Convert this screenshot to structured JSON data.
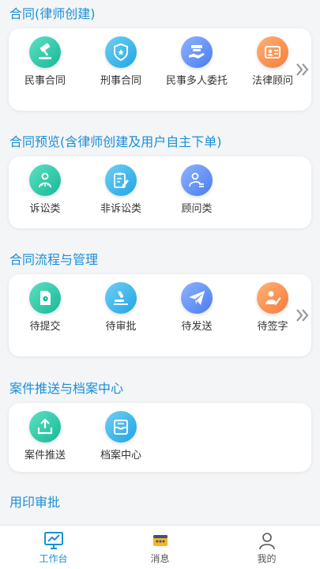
{
  "sections": {
    "create": {
      "title": "合同(律师创建)",
      "items": [
        {
          "label": "民事合同",
          "icon": "gavel-icon"
        },
        {
          "label": "刑事合同",
          "icon": "police-badge-icon"
        },
        {
          "label": "民事多人委托",
          "icon": "handshake-icon"
        },
        {
          "label": "法律顾问",
          "icon": "id-card-icon"
        }
      ]
    },
    "preview": {
      "title": "合同预览(含律师创建及用户自主下单)",
      "items": [
        {
          "label": "诉讼类",
          "icon": "scales-icon"
        },
        {
          "label": "非诉讼类",
          "icon": "clipboard-edit-icon"
        },
        {
          "label": "顾问类",
          "icon": "person-list-icon"
        }
      ]
    },
    "flow": {
      "title": "合同流程与管理",
      "items": [
        {
          "label": "待提交",
          "icon": "document-icon"
        },
        {
          "label": "待审批",
          "icon": "stamp-icon"
        },
        {
          "label": "待发送",
          "icon": "paper-plane-icon"
        },
        {
          "label": "待签字",
          "icon": "signature-icon"
        }
      ]
    },
    "archive": {
      "title": "案件推送与档案中心",
      "items": [
        {
          "label": "案件推送",
          "icon": "upload-icon"
        },
        {
          "label": "档案中心",
          "icon": "inbox-icon"
        }
      ]
    },
    "seal": {
      "title": "用印审批"
    }
  },
  "tabbar": {
    "items": [
      {
        "label": "工作台",
        "icon": "monitor-chart-icon",
        "active": true
      },
      {
        "label": "消息",
        "icon": "message-icon",
        "active": false
      },
      {
        "label": "我的",
        "icon": "user-icon",
        "active": false
      }
    ]
  },
  "colors": {
    "accent": "#1a8fd8",
    "teal": "#16b997",
    "blue": "#20a4e4",
    "indigo": "#4a7cf0",
    "orange": "#f57c3a"
  }
}
